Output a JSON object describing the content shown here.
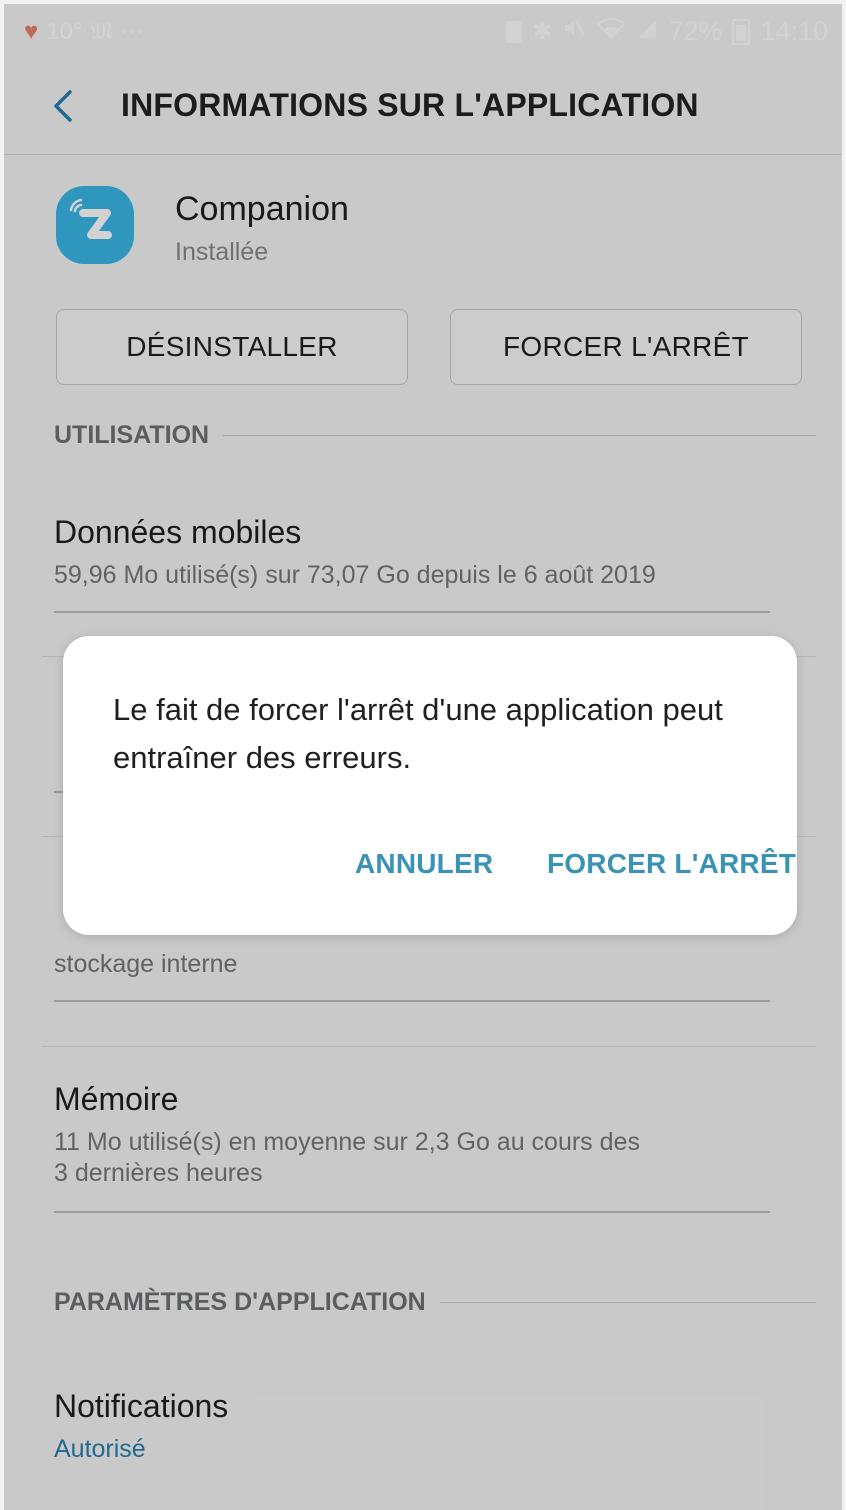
{
  "status_bar": {
    "temperature": "10°",
    "carrier_icon": "𝔐",
    "more": "···",
    "battery_percent": "72%",
    "time": "14:10",
    "icons": [
      "heart-icon",
      "lock-battery-icon",
      "bluetooth-icon",
      "mute-icon",
      "wifi-icon",
      "signal-icon",
      "battery-icon"
    ]
  },
  "header": {
    "title": "INFORMATIONS SUR L'APPLICATION"
  },
  "app": {
    "name": "Companion",
    "status": "Installée",
    "icon_color": "#3ab6e6"
  },
  "buttons": {
    "uninstall": "DÉSINSTALLER",
    "force_stop": "FORCER L'ARRÊT"
  },
  "sections": {
    "usage": "UTILISATION",
    "app_settings": "PARAMÈTRES D'APPLICATION"
  },
  "items": {
    "mobile_data": {
      "title": "Données mobiles",
      "subtitle": "59,96 Mo utilisé(s) sur 73,07 Go depuis le 6 août 2019"
    },
    "storage": {
      "subtitle": "stockage interne"
    },
    "memory": {
      "title": "Mémoire",
      "subtitle_line1": "11 Mo utilisé(s) en moyenne sur 2,3 Go au cours des",
      "subtitle_line2": "3 dernières heures"
    },
    "notifications": {
      "title": "Notifications",
      "subtitle": "Autorisé"
    }
  },
  "dialog": {
    "message": "Le fait de forcer l'arrêt d'une application peut entraîner des erreurs.",
    "cancel_label": "ANNULER",
    "confirm_label": "FORCER L'ARRÊT"
  },
  "colors": {
    "accent": "#2a7fb0",
    "dialog_button": "#3a93b5"
  }
}
